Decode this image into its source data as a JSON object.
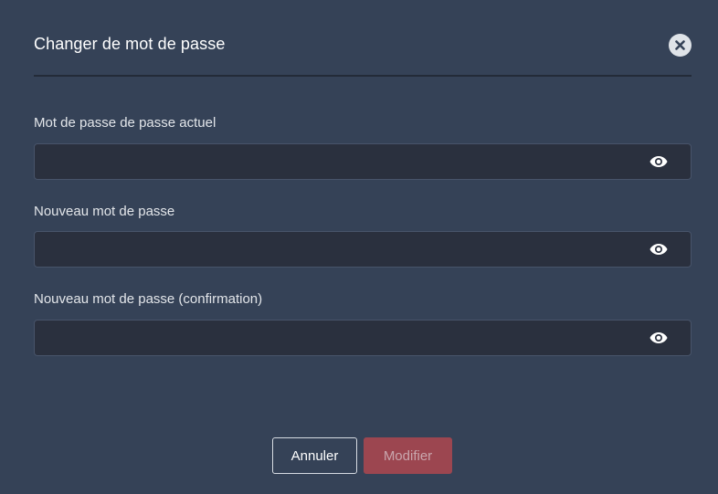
{
  "dialog": {
    "title": "Changer de mot de passe",
    "close_icon": "close-icon"
  },
  "fields": [
    {
      "label": "Mot de passe de passe actuel",
      "value": "",
      "placeholder": "",
      "type": "password",
      "icon": "eye-icon"
    },
    {
      "label": "Nouveau mot de passe",
      "value": "",
      "placeholder": "",
      "type": "password",
      "icon": "eye-icon"
    },
    {
      "label": "Nouveau mot de passe (confirmation)",
      "value": "",
      "placeholder": "",
      "type": "password",
      "icon": "eye-icon"
    }
  ],
  "actions": {
    "cancel_label": "Annuler",
    "submit_label": "Modifier",
    "submit_disabled": true
  },
  "colors": {
    "background": "#354257",
    "input_background": "#2a303e",
    "submit_background": "#9c4650",
    "text": "#ffffff"
  }
}
